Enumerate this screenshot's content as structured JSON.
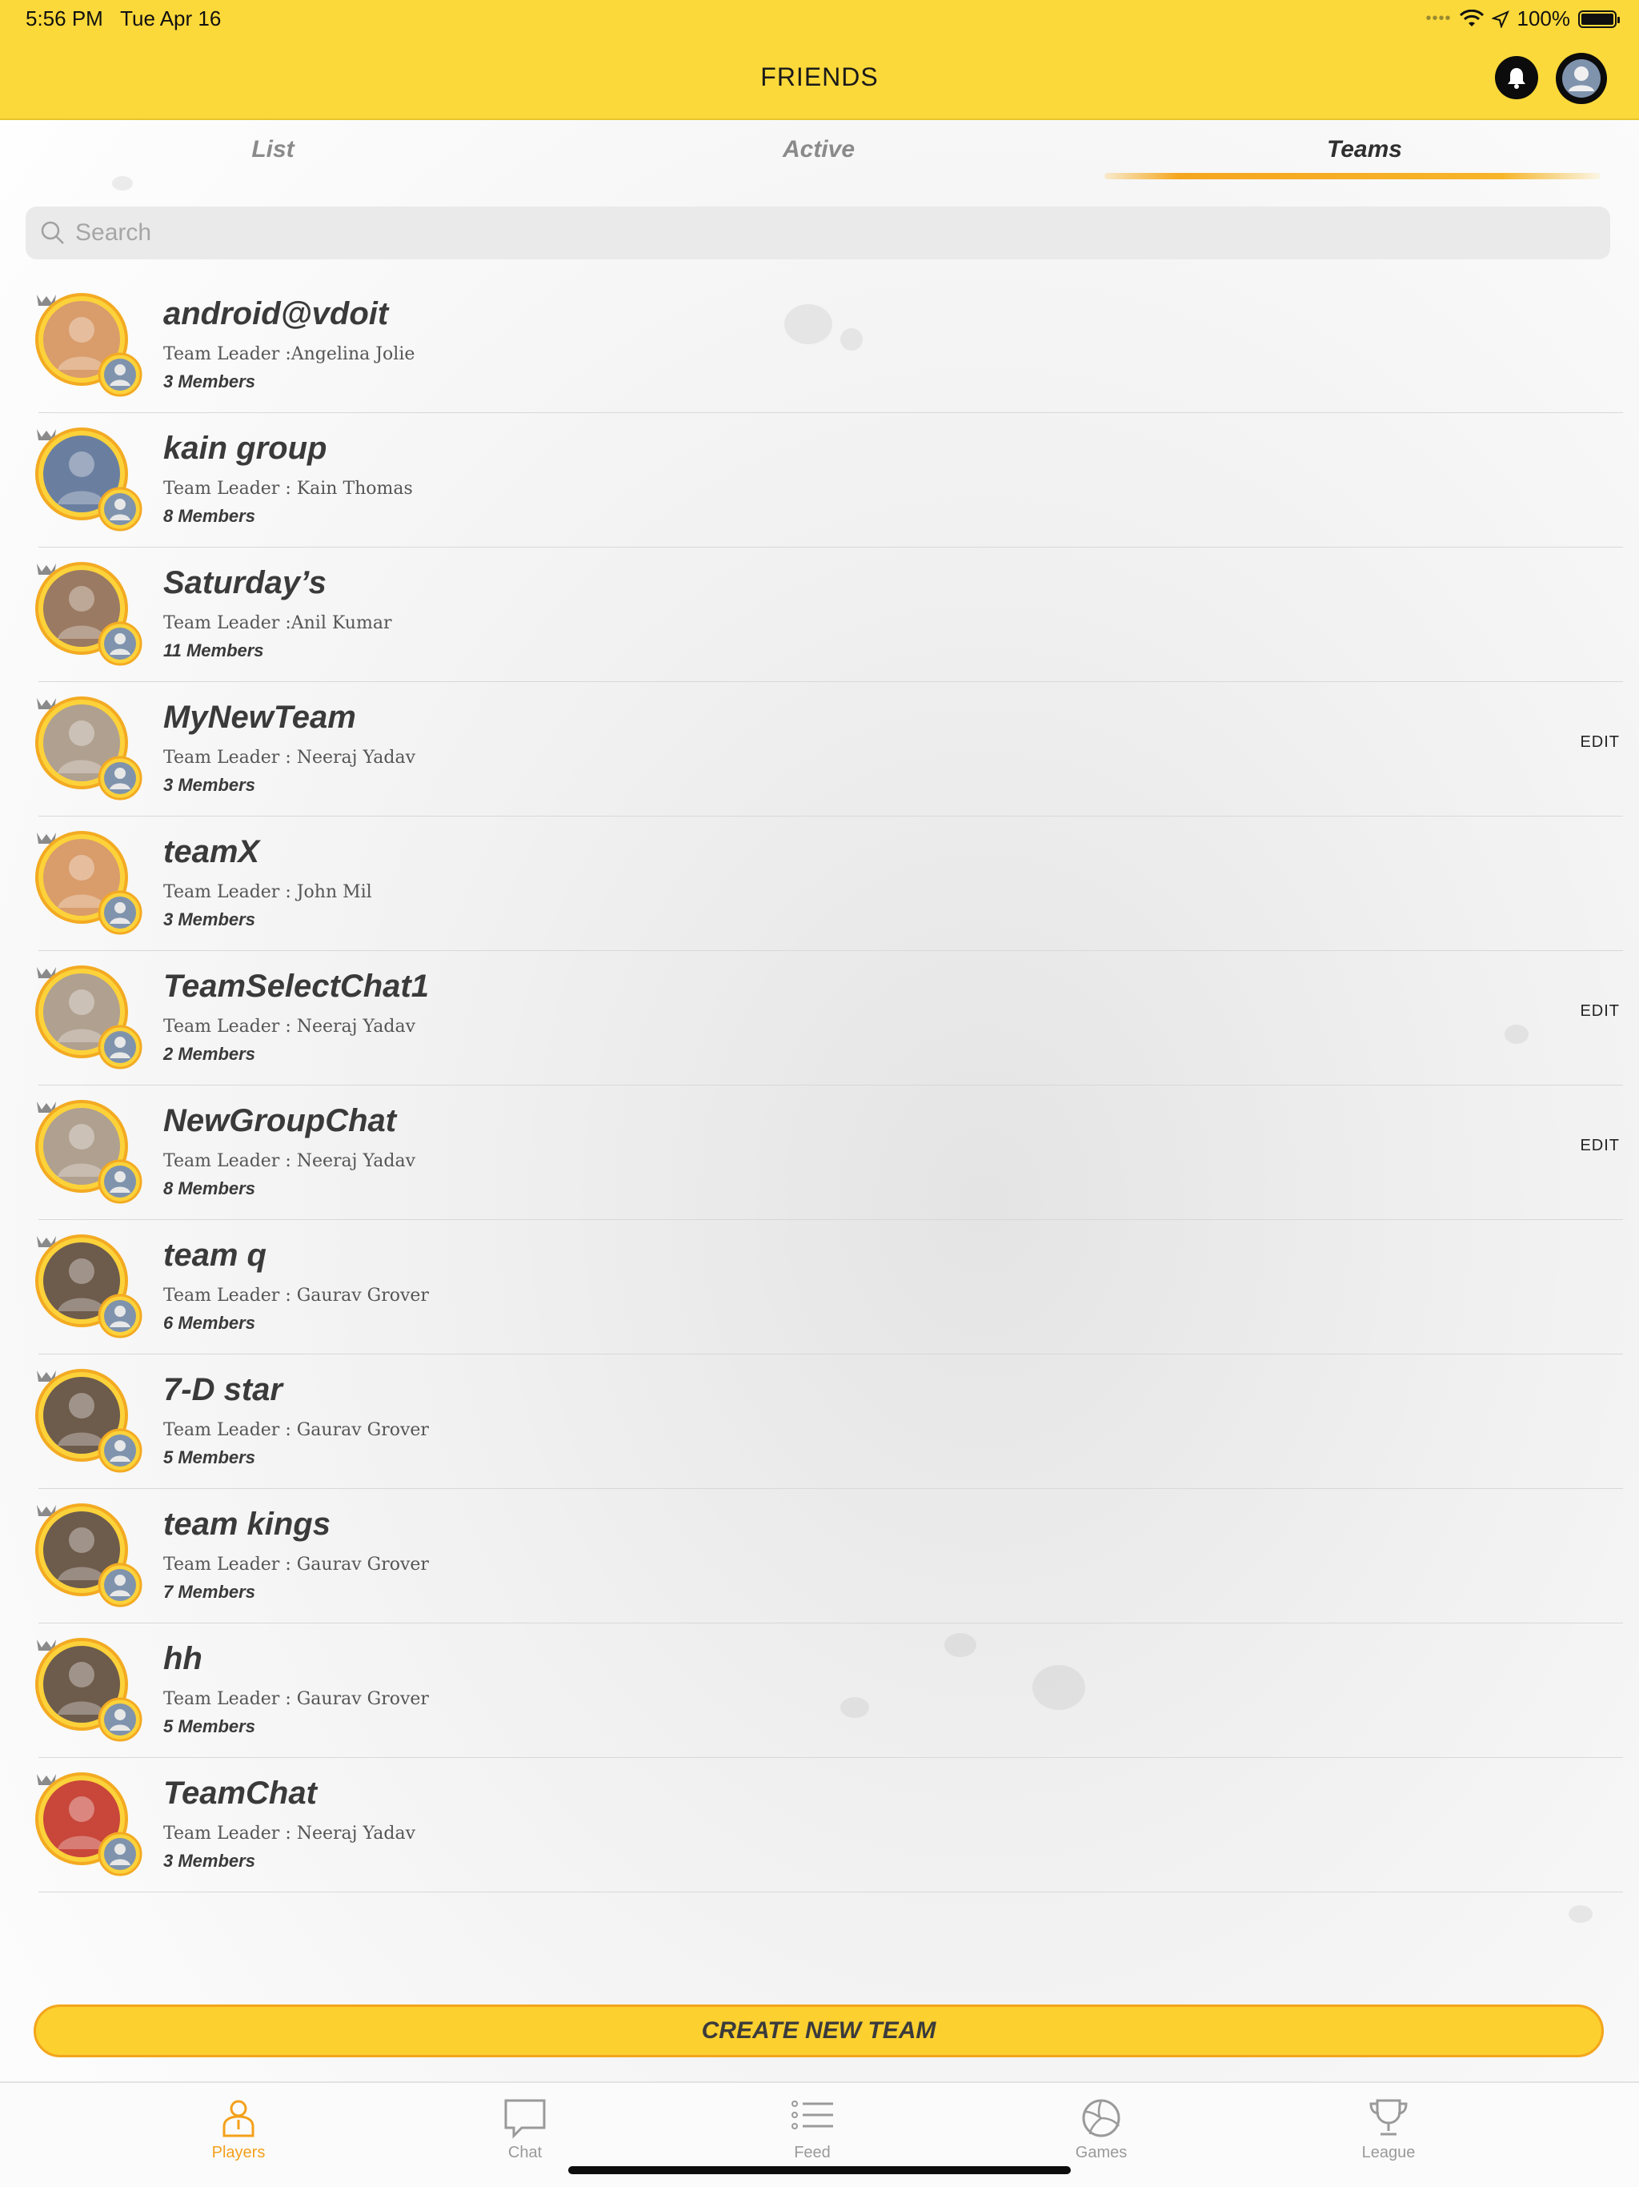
{
  "status_bar": {
    "time": "5:56 PM",
    "date": "Tue Apr 16",
    "battery": "100%"
  },
  "header": {
    "title": "FRIENDS",
    "bell_icon": "bell-icon",
    "profile_icon": "user-avatar-icon"
  },
  "tabs": [
    {
      "label": "List",
      "active": false
    },
    {
      "label": "Active",
      "active": false
    },
    {
      "label": "Teams",
      "active": true
    }
  ],
  "search": {
    "placeholder": "Search",
    "value": ""
  },
  "teams": [
    {
      "name": "android@vdoit",
      "leader": "Team Leader :Angelina Jolie",
      "members": "3 Members",
      "edit": ""
    },
    {
      "name": "kain group",
      "leader": "Team Leader : Kain Thomas",
      "members": "8 Members",
      "edit": ""
    },
    {
      "name": "Saturday’s",
      "leader": "Team Leader :Anil Kumar",
      "members": "11 Members",
      "edit": ""
    },
    {
      "name": "MyNewTeam",
      "leader": "Team Leader : Neeraj Yadav",
      "members": "3 Members",
      "edit": "EDIT"
    },
    {
      "name": "teamX",
      "leader": "Team Leader : John Mil",
      "members": "3 Members",
      "edit": ""
    },
    {
      "name": "TeamSelectChat1",
      "leader": "Team Leader : Neeraj Yadav",
      "members": "2 Members",
      "edit": "EDIT"
    },
    {
      "name": "NewGroupChat",
      "leader": "Team Leader : Neeraj Yadav",
      "members": "8 Members",
      "edit": "EDIT"
    },
    {
      "name": "team q",
      "leader": "Team Leader : Gaurav Grover",
      "members": "6 Members",
      "edit": ""
    },
    {
      "name": "7-D star",
      "leader": "Team Leader : Gaurav Grover",
      "members": "5 Members",
      "edit": ""
    },
    {
      "name": "team kings",
      "leader": "Team Leader : Gaurav Grover",
      "members": "7 Members",
      "edit": ""
    },
    {
      "name": "hh",
      "leader": "Team Leader : Gaurav Grover",
      "members": "5 Members",
      "edit": ""
    },
    {
      "name": "TeamChat",
      "leader": "Team Leader : Neeraj Yadav",
      "members": "3 Members",
      "edit": ""
    }
  ],
  "create_button": {
    "label": "CREATE NEW TEAM"
  },
  "bottom_nav": [
    {
      "label": "Players",
      "icon": "player-icon",
      "active": true
    },
    {
      "label": "Chat",
      "icon": "chat-bubble-icon",
      "active": false
    },
    {
      "label": "Feed",
      "icon": "list-icon",
      "active": false
    },
    {
      "label": "Games",
      "icon": "volleyball-icon",
      "active": false
    },
    {
      "label": "League",
      "icon": "trophy-icon",
      "active": false
    }
  ],
  "colors": {
    "header_yellow": "#fcd93a",
    "accent_orange": "#f4a01a",
    "button_yellow": "#fcd02f"
  }
}
